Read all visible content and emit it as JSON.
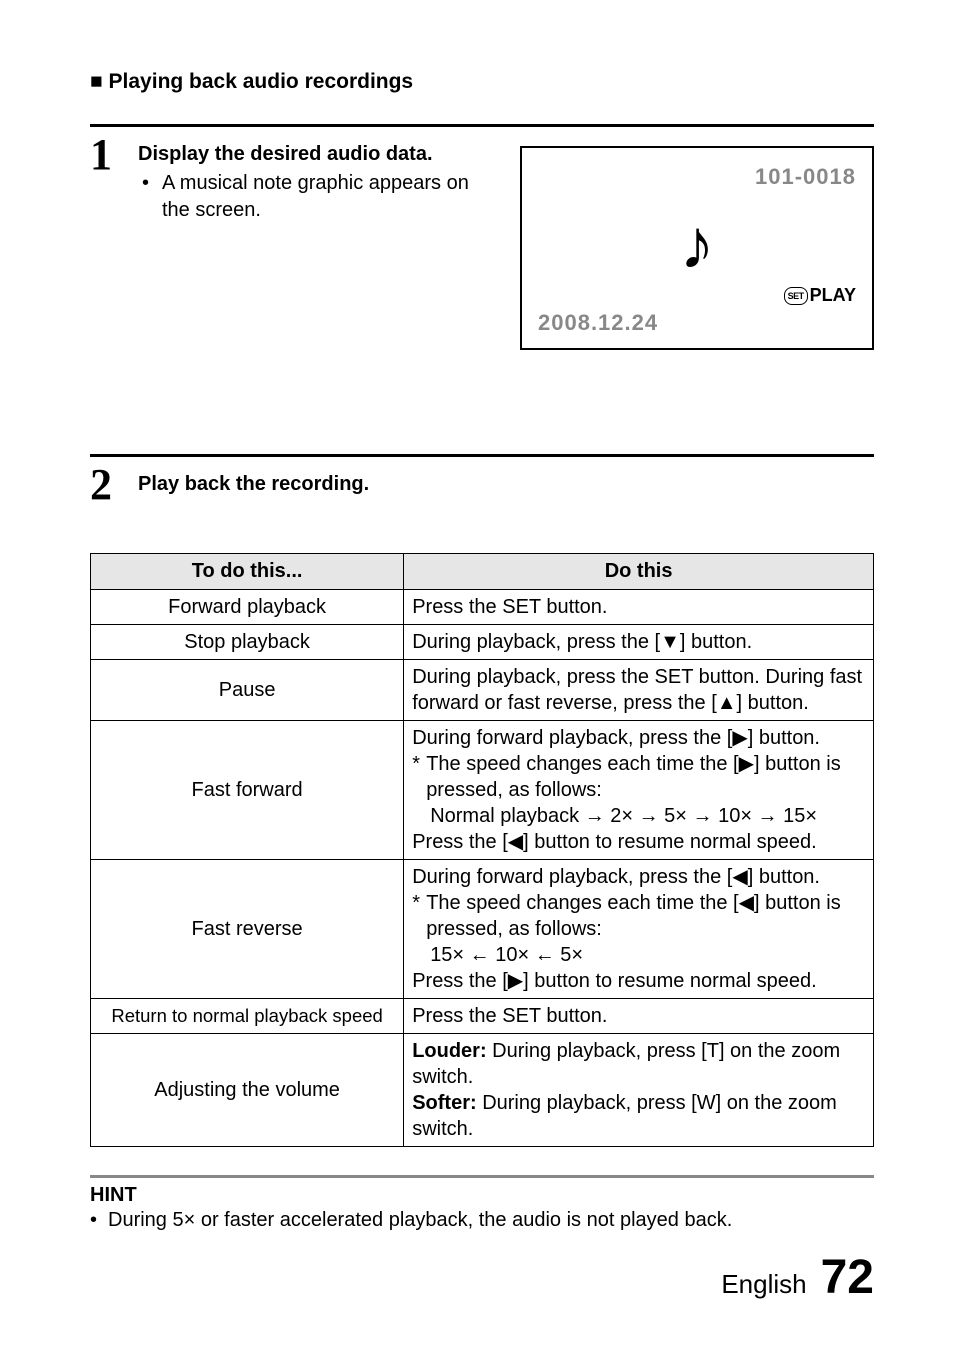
{
  "subhead_bullet": "■",
  "subhead_text": "Playing back audio recordings",
  "step1": {
    "num": "1",
    "title": "Display the desired audio data.",
    "bullet_dot": "•",
    "bullet_text": "A musical note graphic appears on the screen."
  },
  "screen": {
    "file_id": "101-0018",
    "date": "2008.12.24",
    "note_glyph": "♪",
    "set_label": "SET",
    "play_label": "PLAY"
  },
  "step2": {
    "num": "2",
    "title": "Play back the recording."
  },
  "table": {
    "head_left": "To do this...",
    "head_right": "Do this",
    "rows": [
      {
        "left": "Forward playback",
        "right": "Press the SET button."
      },
      {
        "left": "Stop playback",
        "right": "During playback, press the [▼] button."
      },
      {
        "left": "Pause",
        "right": "During playback, press the SET button. During fast forward or fast reverse, press the [▲] button."
      },
      {
        "left": "Fast forward",
        "right_l1": "During forward playback, press the [▶] button.",
        "right_l2a": "*",
        "right_l2b": "The speed changes each time the [▶] button is pressed, as follows:",
        "right_l3": "Normal playback → 2× → 5× → 10× → 15×",
        "right_l4": "Press the [◀] button to resume normal speed."
      },
      {
        "left": "Fast reverse",
        "right_l1": "During forward playback, press the [◀] button.",
        "right_l2a": "*",
        "right_l2b": "The speed changes each time the [◀] button is pressed, as follows:",
        "right_l3": "15× ← 10× ← 5×",
        "right_l4": "Press the [▶] button to resume normal speed."
      },
      {
        "left": "Return to normal playback speed",
        "right": "Press the SET button."
      },
      {
        "left": "Adjusting the volume",
        "right_b1": "Louder:",
        "right_t1": " During playback, press [T] on the zoom switch.",
        "right_b2": "Softer:",
        "right_t2": " During playback, press [W] on the zoom switch."
      }
    ]
  },
  "hint": {
    "title": "HINT",
    "dot": "•",
    "text": "During 5× or faster accelerated playback, the audio is not played back."
  },
  "footer": {
    "lang": "English",
    "page": "72"
  }
}
